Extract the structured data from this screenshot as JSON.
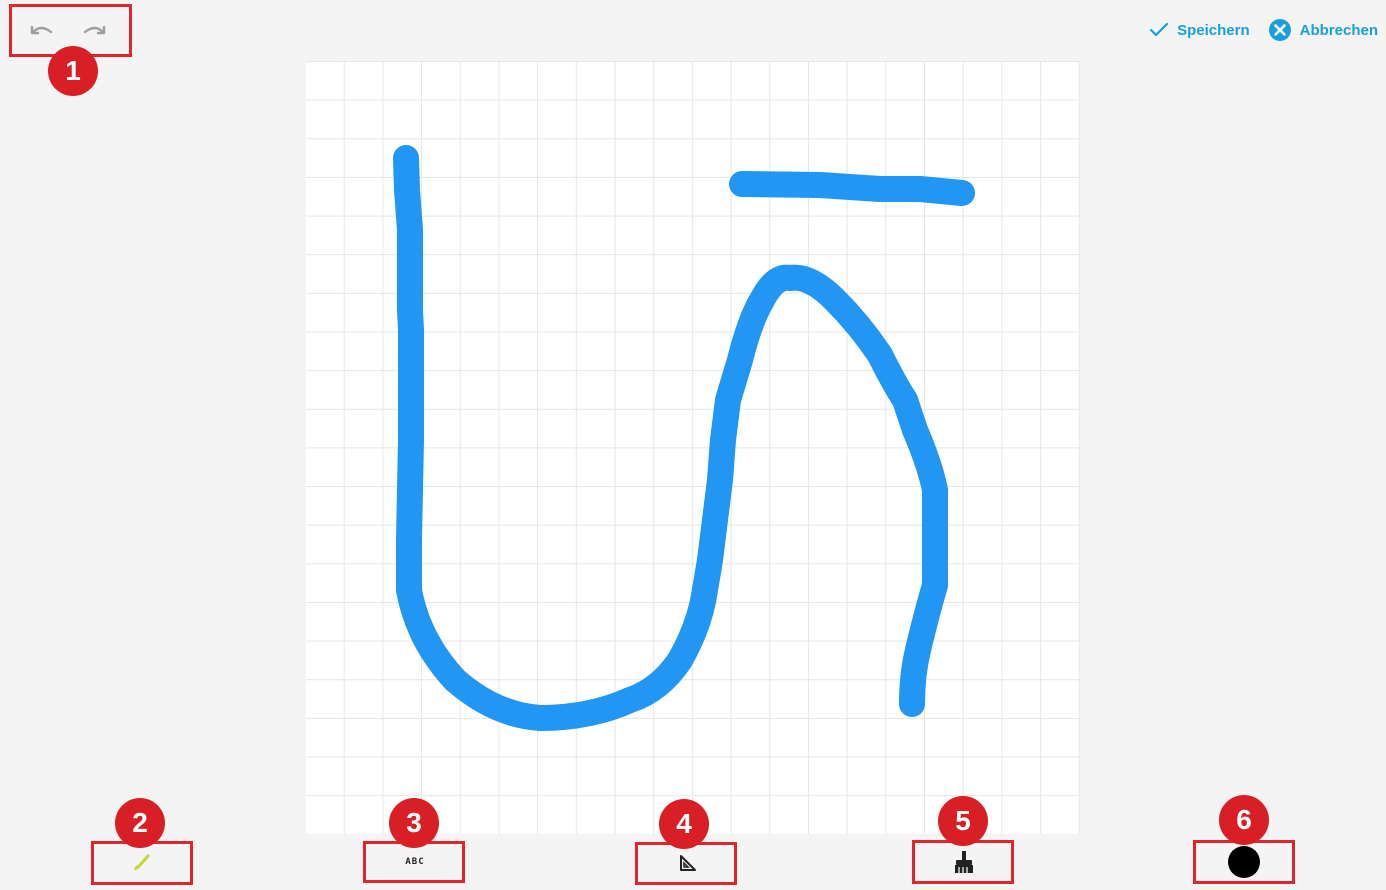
{
  "toolbar_top": {
    "undo_icon": "undo-icon",
    "redo_icon": "redo-icon",
    "icon_color": "#9e9e9e"
  },
  "actions": {
    "save_label": "Speichern",
    "cancel_label": "Abbrechen",
    "accent_color": "#1aa0d8"
  },
  "annotations": [
    "1",
    "2",
    "3",
    "4",
    "5",
    "6"
  ],
  "tools": [
    {
      "name": "brush",
      "icon": "brush-icon",
      "color": "#c6d23a"
    },
    {
      "name": "text",
      "icon": "text-icon",
      "label": "ABC"
    },
    {
      "name": "shapes",
      "icon": "set-square-icon"
    },
    {
      "name": "clear",
      "icon": "broom-icon"
    },
    {
      "name": "color",
      "icon": "color-swatch-icon",
      "color": "#000000"
    }
  ],
  "canvas": {
    "stroke_color": "#2196f3",
    "grid_color": "#e6e6e6"
  }
}
